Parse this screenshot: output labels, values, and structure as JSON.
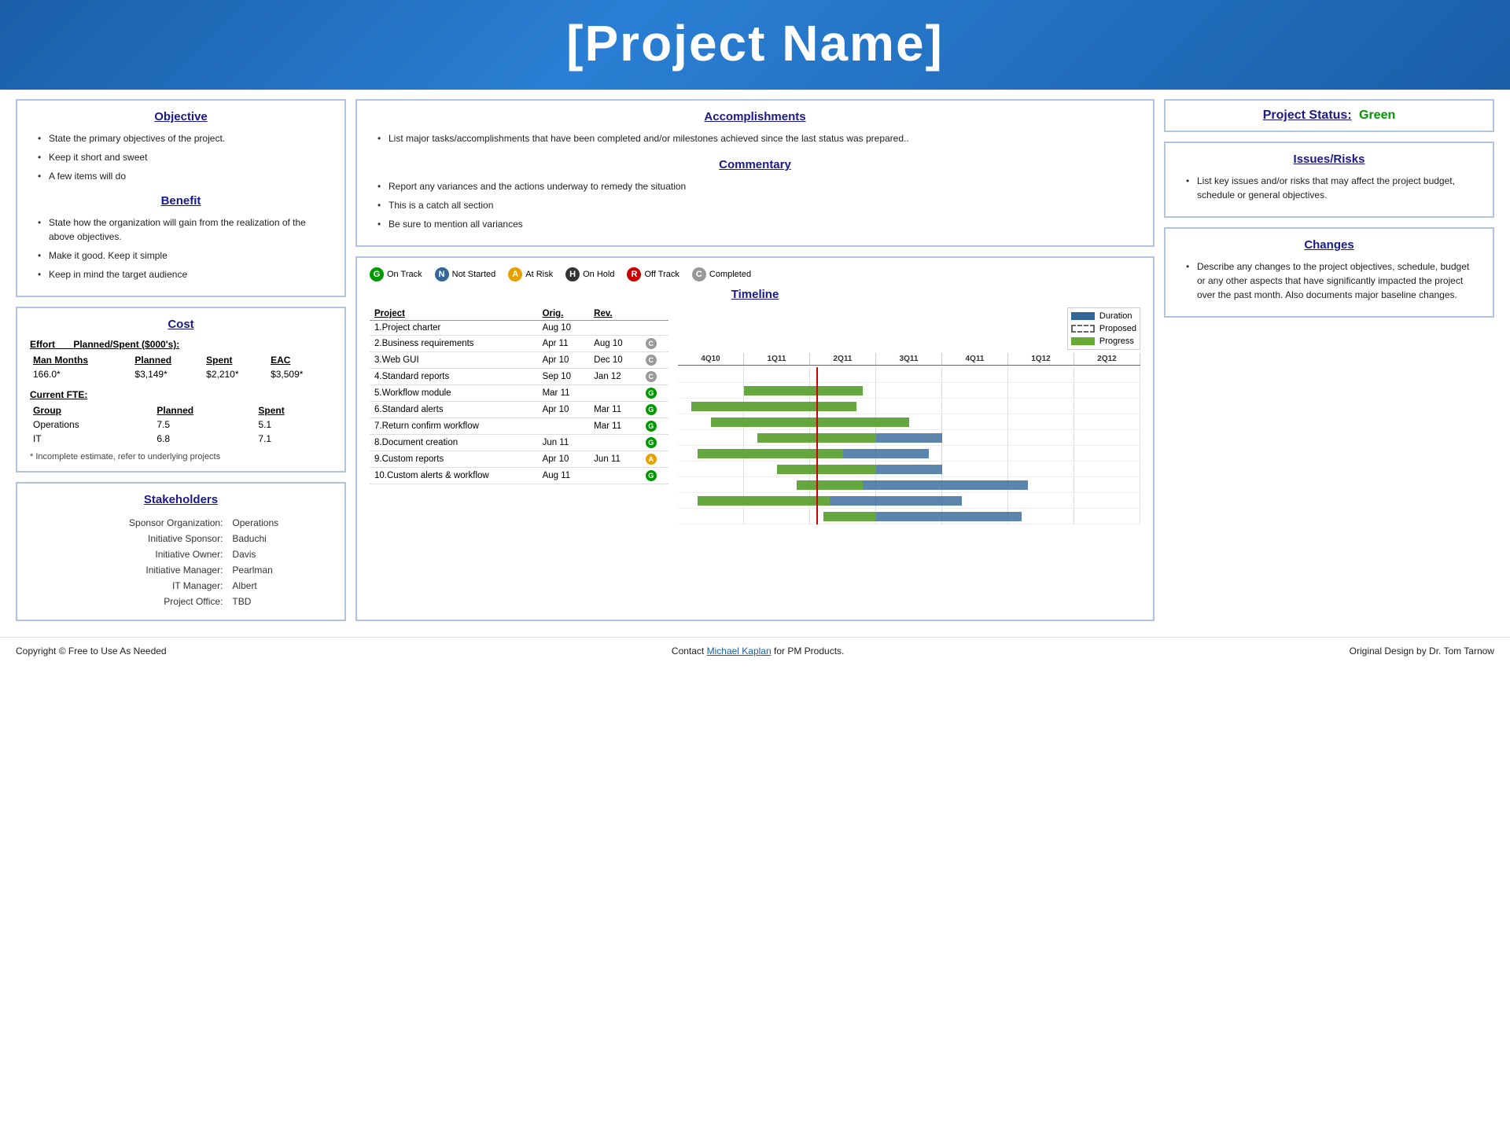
{
  "header": {
    "title": "[Project Name]"
  },
  "objective": {
    "title": "Objective",
    "items": [
      "State the primary objectives of the project.",
      "Keep it short and sweet",
      "A few items will do"
    ]
  },
  "benefit": {
    "title": "Benefit",
    "items": [
      "State how the organization will gain from the realization of the above objectives.",
      "Make it good. Keep it simple",
      "Keep in mind the target audience"
    ]
  },
  "accomplishments": {
    "title": "Accomplishments",
    "items": [
      "List major tasks/accomplishments that have been completed and/or milestones achieved since the last status was prepared.."
    ]
  },
  "commentary": {
    "title": "Commentary",
    "items": [
      "Report any variances and the actions underway to remedy the situation",
      "This is a catch all section",
      "Be sure to mention all variances"
    ]
  },
  "project_status": {
    "title": "Project Status:",
    "value": "Green"
  },
  "issues_risks": {
    "title": "Issues/Risks",
    "items": [
      "List key issues and/or risks that may affect the project budget, schedule or general objectives."
    ]
  },
  "changes": {
    "title": "Changes",
    "items": [
      "Describe any changes to the project objectives, schedule, budget or any other aspects that have significantly impacted the project over the past month. Also documents major baseline changes."
    ]
  },
  "cost": {
    "title": "Cost",
    "effort_label": "Effort",
    "planned_spent_label": "Planned/Spent ($000's):",
    "columns": [
      "Man Months",
      "Planned",
      "Spent",
      "EAC"
    ],
    "rows": [
      [
        "166.0*",
        "$3,149*",
        "$2,210*",
        "$3,509*"
      ]
    ],
    "current_fte_label": "Current FTE:",
    "fte_columns": [
      "Group",
      "Planned",
      "Spent"
    ],
    "fte_rows": [
      [
        "Operations",
        "7.5",
        "5.1"
      ],
      [
        "IT",
        "6.8",
        "7.1"
      ]
    ],
    "note": "* Incomplete estimate, refer to underlying projects"
  },
  "stakeholders": {
    "title": "Stakeholders",
    "rows": [
      [
        "Sponsor Organization:",
        "Operations"
      ],
      [
        "Initiative Sponsor:",
        "Baduchi"
      ],
      [
        "Initiative Owner:",
        "Davis"
      ],
      [
        "Initiative Manager:",
        "Pearlman"
      ],
      [
        "IT Manager:",
        "Albert"
      ],
      [
        "Project Office:",
        "TBD"
      ]
    ]
  },
  "legend": {
    "items": [
      {
        "symbol": "G",
        "color": "green",
        "label": "On Track"
      },
      {
        "symbol": "N",
        "color": "blue",
        "label": "Not Started"
      },
      {
        "symbol": "A",
        "color": "yellow",
        "label": "At Risk"
      },
      {
        "symbol": "H",
        "color": "dark",
        "label": "On Hold"
      },
      {
        "symbol": "R",
        "color": "red",
        "label": "Off Track"
      },
      {
        "symbol": "C",
        "color": "gray",
        "label": "Completed"
      }
    ]
  },
  "timeline": {
    "title": "Timeline",
    "projects": [
      {
        "name": "1.Project charter",
        "orig": "Aug 10",
        "rev": "",
        "status": null,
        "bar_start": 0,
        "bar_end": 0
      },
      {
        "name": "2.Business requirements",
        "orig": "Apr 11",
        "rev": "Aug 10",
        "status": "C",
        "bar_start": 15,
        "bar_end": 35
      },
      {
        "name": "3.Web GUI",
        "orig": "Apr 10",
        "rev": "Dec 10",
        "status": "C",
        "bar_start": 5,
        "bar_end": 45
      },
      {
        "name": "4.Standard reports",
        "orig": "Sep 10",
        "rev": "Jan 12",
        "status": "C",
        "bar_start": 10,
        "bar_end": 50
      },
      {
        "name": "5.Workflow module",
        "orig": "Mar 11",
        "rev": "",
        "status": "G",
        "bar_start": 20,
        "bar_end": 55
      },
      {
        "name": "6.Standard alerts",
        "orig": "Apr 10",
        "rev": "Mar 11",
        "status": "G",
        "bar_start": 5,
        "bar_end": 60
      },
      {
        "name": "7.Return confirm workflow",
        "orig": "",
        "rev": "Mar 11",
        "status": "G",
        "bar_start": 25,
        "bar_end": 58
      },
      {
        "name": "8.Document creation",
        "orig": "Jun 11",
        "rev": "",
        "status": "G",
        "bar_start": 30,
        "bar_end": 75
      },
      {
        "name": "9.Custom reports",
        "orig": "Apr 10",
        "rev": "Jun 11",
        "status": "A",
        "bar_start": 5,
        "bar_end": 70
      },
      {
        "name": "10.Custom alerts & workflow",
        "orig": "Aug 11",
        "rev": "",
        "status": "G",
        "bar_start": 35,
        "bar_end": 68
      }
    ],
    "axis_labels": [
      "4Q10",
      "1Q11",
      "2Q11",
      "3Q11",
      "4Q11",
      "1Q12",
      "2Q12"
    ],
    "legend": {
      "duration": "Duration",
      "proposed": "Proposed",
      "progress": "Progress"
    }
  },
  "footer": {
    "left": "Copyright © Free to Use As Needed",
    "center_pre": "Contact ",
    "center_link_text": "Michael Kaplan",
    "center_link_href": "#",
    "center_post": " for PM Products.",
    "right": "Original Design by Dr. Tom Tarnow"
  }
}
